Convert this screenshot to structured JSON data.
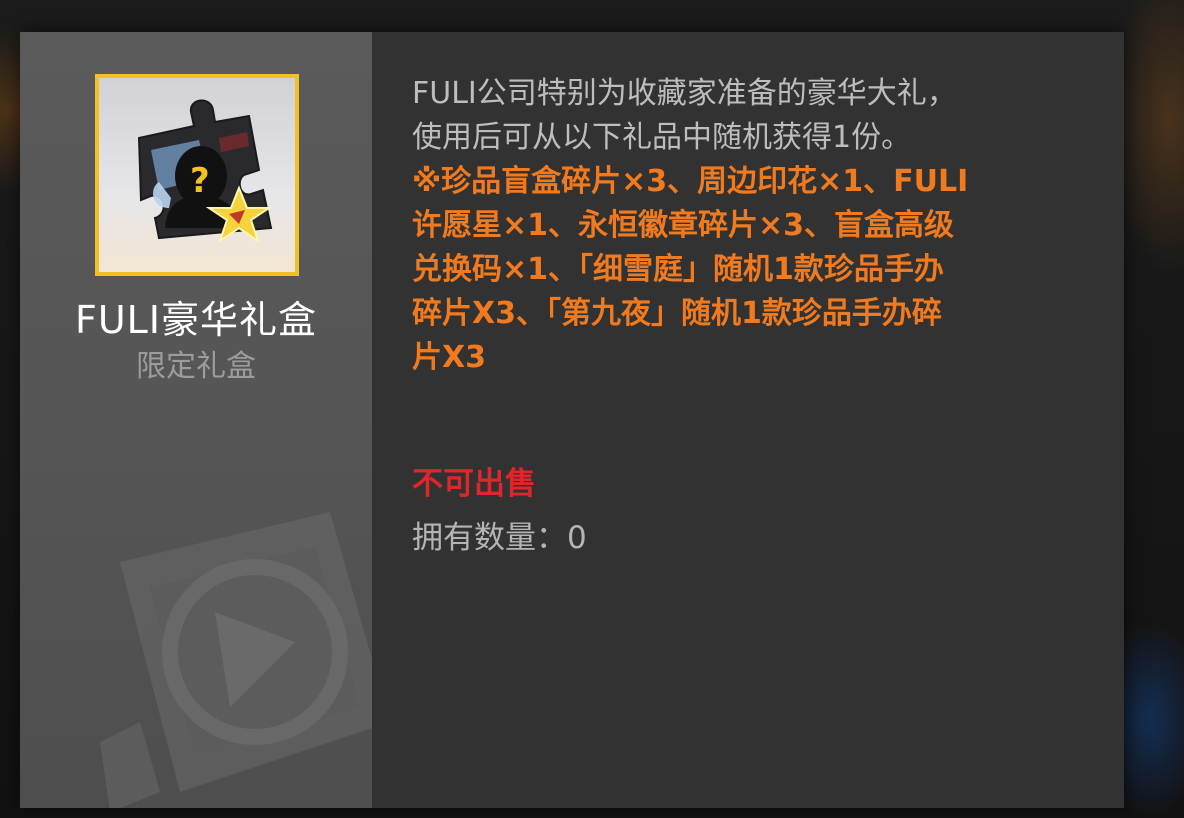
{
  "item": {
    "name": "FULI豪华礼盒",
    "type": "限定礼盒",
    "icon": "mystery-puzzle-gift-icon"
  },
  "description": {
    "line1": "FULI公司特别为收藏家准备的豪华大礼，",
    "line2": "使用后可从以下礼品中随机获得1份。",
    "contents": [
      "※珍品盲盒碎片×3、周边印花×1、FULI",
      "许愿星×1、永恒徽章碎片×3、盲盒高级",
      "兑换码×1、「细雪庭」随机1款珍品手办",
      "碎片X3、「第九夜」随机1款珍品手办碎",
      "片X3"
    ]
  },
  "status": {
    "sellable_label": "不可出售",
    "owned_label": "拥有数量：",
    "owned_count": "0"
  },
  "colors": {
    "frame_border": "#f2c123",
    "contents_text": "#f07a1d",
    "warning_text": "#e0262a"
  }
}
